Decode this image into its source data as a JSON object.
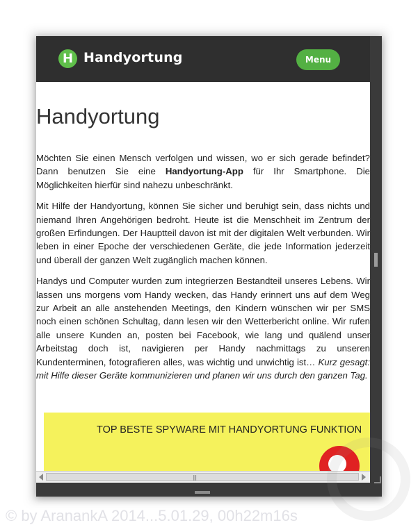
{
  "nav": {
    "logo_letter": "H",
    "brand": "Handyortung",
    "menu_label": "Menu"
  },
  "article": {
    "title": "Handyortung",
    "p1_before": "Möchten Sie einen Mensch verfolgen und wissen, wo er sich gerade befindet? Dann benutzen Sie eine ",
    "p1_bold": "Handyortung-App",
    "p1_after": " für Ihr Smartphone. Die Möglichkeiten hierfür sind nahezu unbeschränkt.",
    "p2": "Mit Hilfe der Handyortung, können Sie sicher und beruhigt sein, dass nichts und niemand Ihren Angehörigen bedroht. Heute ist die Menschheit im Zentrum der großen Erfindungen. Der Hauptteil davon ist mit der digitalen Welt verbunden. Wir leben in einer Epoche der verschiedenen Geräte, die jede Information jederzeit und überall der ganzen Welt zugänglich machen können.",
    "p3_normal": "Handys und Computer wurden zum integrierzen Bestandteil unseres Lebens. Wir lassen uns morgens vom Handy wecken, das Handy erinnert uns auf dem Weg zur Arbeit an alle anstehenden Meetings, den Kindern wünschen wir per SMS noch einen schönen Schultag, dann lesen wir den Wetterbericht online. Wir rufen alle unsere Kunden an, posten bei Facebook, wie lang und quälend unser Arbeitstag doch ist, navigieren per Handy nachmittags zu unseren Kundenterminen, fotografieren alles, was wichtig und unwichtig ist… ",
    "p3_italic": "Kurz gesagt: mit Hilfe dieser Geräte kommunizieren und planen wir uns durch den ganzen Tag."
  },
  "promo": {
    "text": "TOP BESTE SPYWARE MIT HANDYORTUNG FUNKTION",
    "background": "#f5f25c"
  },
  "watermark": "© by AranankA 2014...5.01.29, 00h22m16s",
  "colors": {
    "navbar": "#2f2f2f",
    "accent_green": "#53b043"
  }
}
